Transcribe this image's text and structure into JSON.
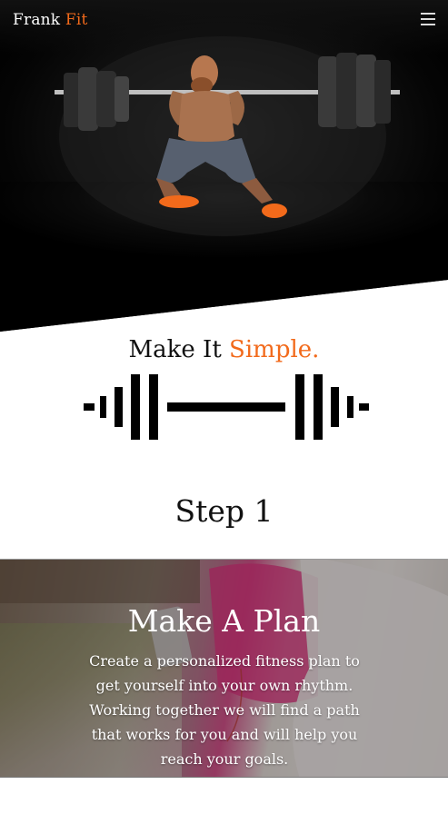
{
  "nav": {
    "brand_first": "Frank",
    "brand_second": "Fit",
    "menu_icon": "hamburger-icon"
  },
  "hero": {
    "image": "weightlifter-squat-photo"
  },
  "intro": {
    "tagline_start": "Make It",
    "tagline_accent": "Simple.",
    "icon": "barbell-icon"
  },
  "step": {
    "label": "Step 1"
  },
  "plan": {
    "title": "Make A Plan",
    "text": "Create a personalized fitness plan to get yourself into your own rhythm. Working together we will find a path that works for you and will help you reach your goals.",
    "image": "woman-with-phone-photo"
  },
  "colors": {
    "accent": "#f26a1b",
    "text": "#111111",
    "white": "#ffffff"
  }
}
